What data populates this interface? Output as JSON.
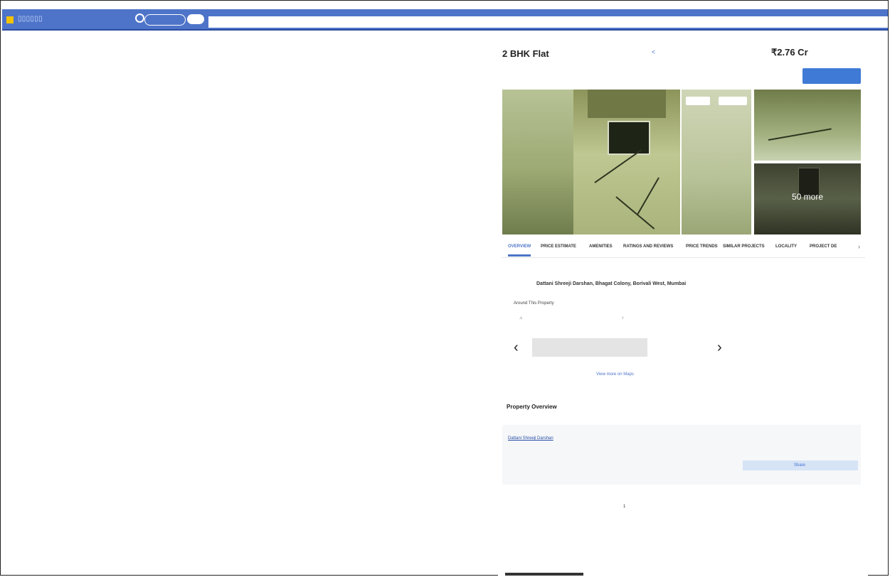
{
  "header": {
    "logo_text": "▯▯▯▯▯▯",
    "location_text": "",
    "search_pill": "",
    "add_pill": ""
  },
  "listing": {
    "breadcrumb": "",
    "posted_by": "",
    "title": "2 BHK Flat",
    "society_link": "",
    "specs": "",
    "price": "₹2.76 Cr",
    "emi_link": "",
    "sub_price": "",
    "contact_button": ""
  },
  "gallery": {
    "share_button": "",
    "save_button": "",
    "more_count": "50 more"
  },
  "tabs": [
    {
      "label": "OVERVIEW",
      "active": true
    },
    {
      "label": "PRICE ESTIMATE",
      "active": false
    },
    {
      "label": "AMENITIES",
      "active": false
    },
    {
      "label": "RATINGS AND REVIEWS",
      "active": false
    },
    {
      "label": "PRICE TRENDS",
      "active": false
    },
    {
      "label": "SIMILAR PROJECTS",
      "active": false
    },
    {
      "label": "LOCALITY",
      "active": false
    },
    {
      "label": "PROJECT DE",
      "active": false
    }
  ],
  "location": {
    "address_label": "",
    "address": "Dattani Shreeji Darshan, Bhagat Colony, Borivali West, Mumbai",
    "around_title": "Around This Property",
    "pois": [
      {
        "name": "",
        "detail": ""
      },
      {
        "name": "",
        "detail": ""
      },
      {
        "name": "",
        "detail": ""
      },
      {
        "name": "",
        "detail": ""
      }
    ],
    "view_map": "View more on Maps"
  },
  "overview": {
    "title": "Property Overview",
    "project_label": "",
    "project_value": "Dattani Shreeji Darshan",
    "developer_label": "",
    "developer_value": "",
    "developer_link": "",
    "highlight_title": "",
    "highlight_text": "",
    "highlight_button": "Share",
    "area_value": "",
    "config_value": "",
    "floor_value": "",
    "bathrooms_value": "1",
    "parking_label": "",
    "parking_value": "",
    "posted_label": "",
    "posted_value": ""
  }
}
